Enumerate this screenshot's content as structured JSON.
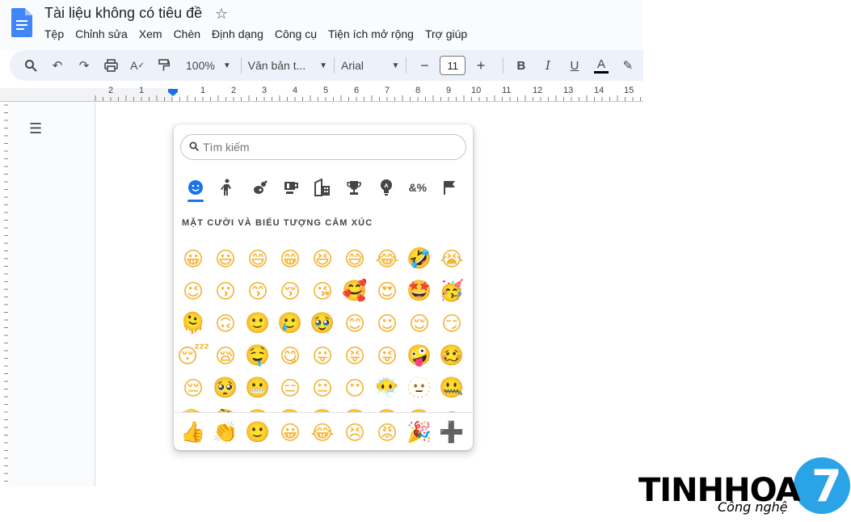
{
  "header": {
    "title": "Tài liệu không có tiêu đề",
    "menu": [
      "Tệp",
      "Chỉnh sửa",
      "Xem",
      "Chèn",
      "Định dạng",
      "Công cụ",
      "Tiện ích mở rộng",
      "Trợ giúp"
    ]
  },
  "toolbar": {
    "zoom": "100%",
    "style": "Văn bản t...",
    "font": "Arial",
    "font_size": "11",
    "minus": "−",
    "plus": "+",
    "bold": "B",
    "italic": "I",
    "underline": "U",
    "text_color": "A"
  },
  "ruler": {
    "ticks": [
      "2",
      "1",
      "1",
      "2",
      "3",
      "4",
      "5",
      "6",
      "7",
      "8",
      "9",
      "10",
      "11",
      "12",
      "13",
      "14",
      "15"
    ]
  },
  "emoji_picker": {
    "search_placeholder": "Tìm kiếm",
    "section_heading": "MẶT CƯỜI VÀ BIỂU TƯỢNG CẢM XÚC",
    "categories": [
      {
        "name": "smileys",
        "glyph": "☺",
        "active": true
      },
      {
        "name": "people",
        "glyph": "🚶"
      },
      {
        "name": "animals-nature",
        "glyph": "🐾"
      },
      {
        "name": "food-drink",
        "glyph": "☕"
      },
      {
        "name": "travel-places",
        "glyph": "🏢"
      },
      {
        "name": "activities",
        "glyph": "🏆"
      },
      {
        "name": "objects",
        "glyph": "💡"
      },
      {
        "name": "symbols",
        "glyph": "&%"
      },
      {
        "name": "flags",
        "glyph": "⚑"
      }
    ],
    "emojis": [
      "😀",
      "😃",
      "😄",
      "😁",
      "😆",
      "😅",
      "😂",
      "🤣",
      "😭",
      "😉",
      "😗",
      "😙",
      "😚",
      "😘",
      "🥰",
      "😍",
      "🤩",
      "🥳",
      "🫠",
      "🙃",
      "🙂",
      "🥲",
      "🥹",
      "😊",
      "☺",
      "😌",
      "😏",
      "😴",
      "😪",
      "🤤",
      "😋",
      "😛",
      "😝",
      "😜",
      "🤪",
      "🥴",
      "😔",
      "🥺",
      "😬",
      "😑",
      "😐",
      "😶",
      "😶‍🌫️",
      "🫥",
      "🤐",
      "🫡",
      "🤔",
      "🤫",
      "🫢",
      "🤭",
      "🥱",
      "🤗",
      "🫣",
      "😱"
    ],
    "recent": [
      "👍",
      "👏",
      "🙂",
      "😀",
      "😂",
      "😣",
      "😡",
      "🎉",
      "➕"
    ]
  },
  "brand": {
    "name": "TINHHOA",
    "numeral": "7",
    "tagline": "Công nghệ",
    "color": "#2aa4e6"
  }
}
